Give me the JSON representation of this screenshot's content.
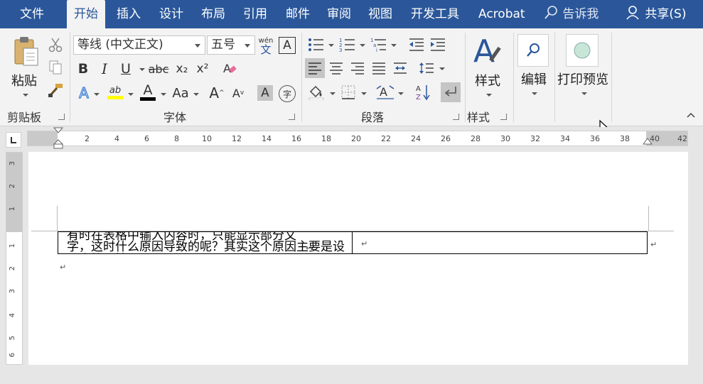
{
  "tabs": [
    {
      "label": "文件"
    },
    {
      "label": "开始"
    },
    {
      "label": "插入"
    },
    {
      "label": "设计"
    },
    {
      "label": "布局"
    },
    {
      "label": "引用"
    },
    {
      "label": "邮件"
    },
    {
      "label": "审阅"
    },
    {
      "label": "视图"
    },
    {
      "label": "开发工具"
    },
    {
      "label": "Acrobat"
    }
  ],
  "active_tab": "开始",
  "tell_me": "告诉我",
  "share": "共享(S)",
  "clipboard": {
    "paste": "粘贴",
    "group": "剪贴板"
  },
  "font": {
    "name": "等线 (中文正文)",
    "size": "五号",
    "phonetic_top": "wén",
    "phonetic_bottom": "文",
    "border_char": "A",
    "group": "字体",
    "bold": "B",
    "italic": "I",
    "underline": "U",
    "strike": "abc",
    "subscript": "x₂",
    "superscript": "x²",
    "text_effect": "A",
    "highlight": "ab",
    "font_color": "A",
    "change_case": "Aa",
    "grow": "A",
    "shrink": "A",
    "shade": "A",
    "enclose": "字"
  },
  "paragraph": {
    "group": "段落"
  },
  "styles": {
    "label": "样式",
    "group": "样式"
  },
  "editing": {
    "label": "编辑"
  },
  "print_preview": {
    "label": "打印预览"
  },
  "ruler_ticks": [
    "2",
    "4",
    "6",
    "8",
    "10",
    "12",
    "14",
    "16",
    "18",
    "20",
    "22",
    "24",
    "26",
    "28",
    "30",
    "32",
    "34",
    "36",
    "38",
    "40",
    "42"
  ],
  "vruler_ticks_top": [
    "3",
    "2",
    "1"
  ],
  "vruler_ticks_bottom": [
    "1",
    "2",
    "3",
    "4",
    "5",
    "6"
  ],
  "document": {
    "cell1_line1": "有时在表格中输入内容时，只能显示部分文",
    "cell1_line2": "字，这时什么原因导致的呢？其实这个原因主要是设置表格属性",
    "para_mark": "↵"
  },
  "colors": {
    "accent": "#2b579a",
    "highlight_bar": "#ffff00",
    "font_color_bar": "#000000"
  }
}
